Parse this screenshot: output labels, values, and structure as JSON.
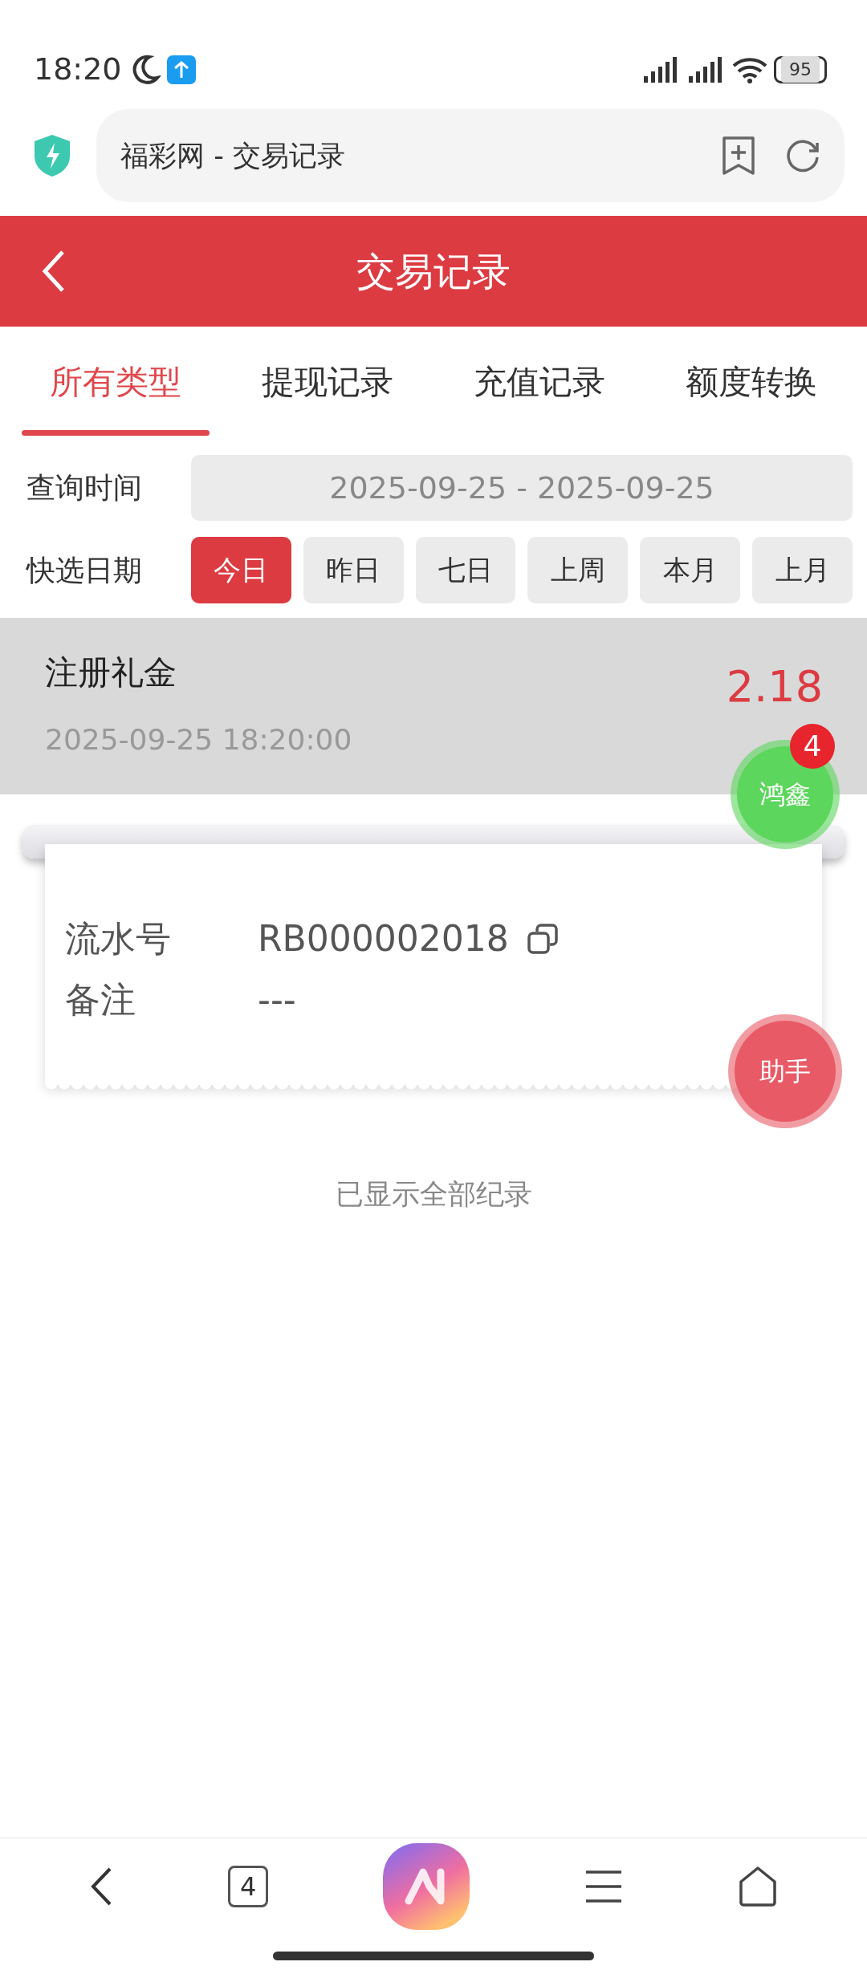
{
  "status_bar": {
    "time": "18:20",
    "battery": "95"
  },
  "browser": {
    "title": "福彩网 - 交易记录"
  },
  "header": {
    "title": "交易记录"
  },
  "tabs": [
    {
      "label": "所有类型",
      "selected": true
    },
    {
      "label": "提现记录",
      "selected": false
    },
    {
      "label": "充值记录",
      "selected": false
    },
    {
      "label": "额度转换",
      "selected": false
    }
  ],
  "query": {
    "label": "查询时间",
    "value": "2025-09-25 - 2025-09-25"
  },
  "quick_dates": {
    "label": "快选日期",
    "options": [
      {
        "label": "今日",
        "selected": true
      },
      {
        "label": "昨日",
        "selected": false
      },
      {
        "label": "七日",
        "selected": false
      },
      {
        "label": "上周",
        "selected": false
      },
      {
        "label": "本月",
        "selected": false
      },
      {
        "label": "上月",
        "selected": false
      }
    ]
  },
  "records": [
    {
      "title": "注册礼金",
      "time": "2025-09-25 18:20:00",
      "amount": "2.18",
      "expanded": true,
      "details": [
        {
          "label": "流水号",
          "value": "RB000002018",
          "copyable": true
        },
        {
          "label": "备注",
          "value": "---",
          "copyable": false
        }
      ]
    }
  ],
  "footer_note": "已显示全部纪录",
  "floating_buttons": [
    {
      "label": "鸿鑫",
      "color": "#5cd65c",
      "badge": "4"
    },
    {
      "label": "助手",
      "color": "#e85a66"
    }
  ],
  "bottom_nav": {
    "tab_count": "4"
  }
}
